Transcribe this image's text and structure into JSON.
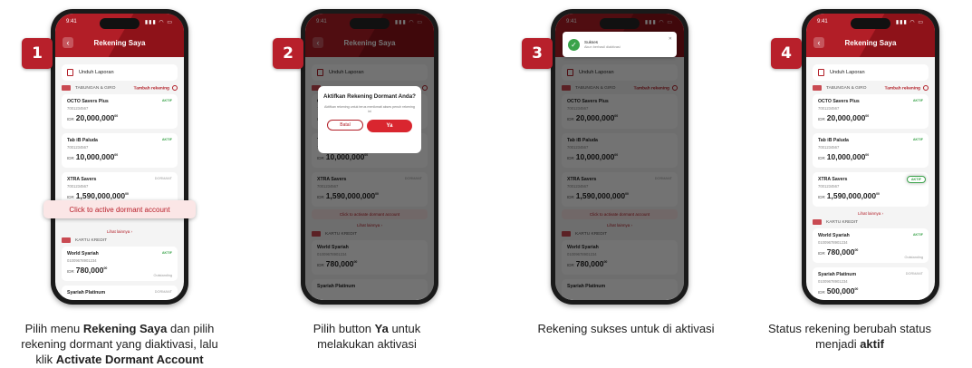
{
  "app": {
    "time": "9:41",
    "status_icons": "▮▮▮ ◠ ▭",
    "title": "Rekening Saya",
    "unduh": "Unduh Laporan",
    "section_tabungan": "TABUNGAN & GIRO",
    "tambah": "Tambah rekening",
    "section_kartu": "KARTU KREDIT",
    "lihat": "Lihat lainnya",
    "accounts": [
      {
        "name": "OCTO Savers Plus",
        "number": "7001234567",
        "currency": "IDR",
        "balance": "20,000,000",
        "cents": "00",
        "status": "AKTIF"
      },
      {
        "name": "Tab iB Paluda",
        "number": "7001234567",
        "currency": "IDR",
        "balance": "10,000,000",
        "cents": "00",
        "status": "AKTIF"
      },
      {
        "name": "XTRA Savers",
        "number": "7001234567",
        "currency": "IDR",
        "balance": "1,590,000,000",
        "cents": "00",
        "status_dormant": "DORMANT",
        "status_active": "AKTIF"
      }
    ],
    "cards": [
      {
        "name": "World Syariah",
        "number": "01009678901234",
        "currency": "IDR",
        "balance": "780,000",
        "cents": "00",
        "status": "AKTIF",
        "foot": "Outstanding"
      },
      {
        "name": "Syariah Platinum",
        "number": "01009678901234",
        "currency": "IDR",
        "balance": "500,000",
        "cents": "00",
        "status": "DORMANT"
      }
    ],
    "callout_small": "Click to activate dormant account"
  },
  "steps": [
    {
      "number": "1",
      "callout": "Click to active dormant account",
      "caption_1": "Pilih menu ",
      "caption_b1": "Rekening Saya",
      "caption_2": " dan pilih",
      "caption_3": "rekening dormant yang diaktivasi, lalu",
      "caption_4": "klik ",
      "caption_b2": "Activate Dormant Account"
    },
    {
      "number": "2",
      "dialog_title": "Aktifkan Rekening Dormant Anda?",
      "dialog_text": "Aktifkan rekening untuk terus menikmati akses penuh rekening ini",
      "btn_batal": "Batal",
      "btn_ya": "Ya",
      "caption_1": "Pilih button ",
      "caption_b1": "Ya",
      "caption_2": " untuk",
      "caption_3": "melakukan aktivasi"
    },
    {
      "number": "3",
      "toast_title": "Sukses",
      "toast_sub": "Akun berhasil diaktivasi",
      "caption_1": "Rekening sukses untuk di aktivasi"
    },
    {
      "number": "4",
      "caption_1": "Status rekening berubah status",
      "caption_2": "menjadi ",
      "caption_b1": "aktif"
    }
  ]
}
